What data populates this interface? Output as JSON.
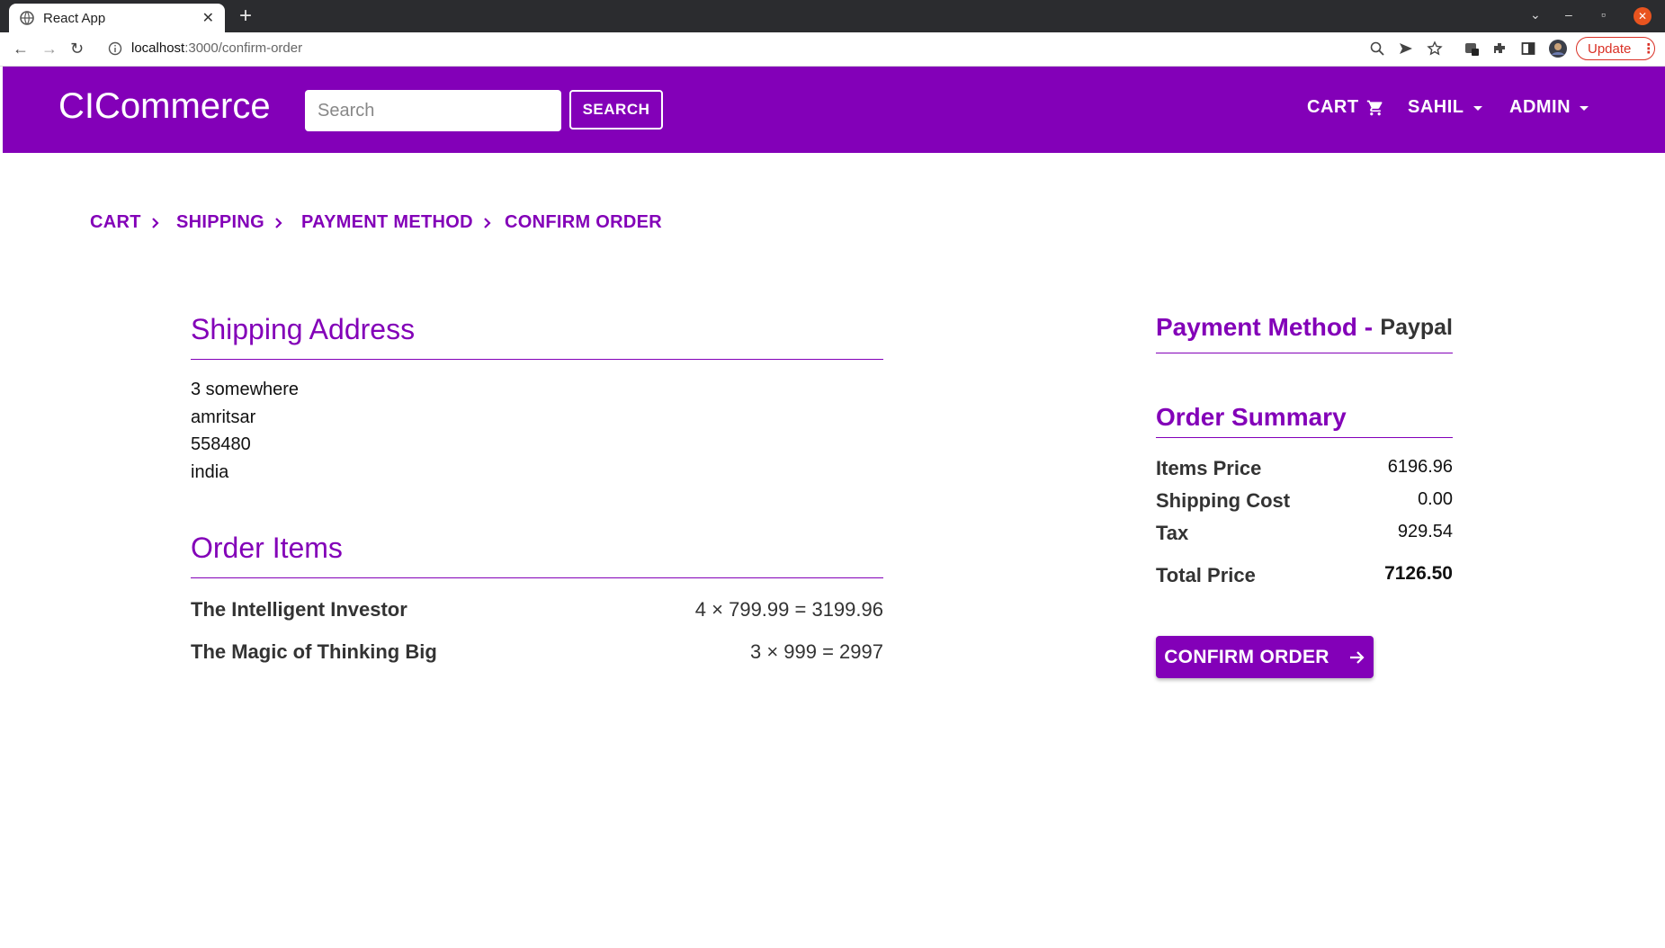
{
  "browser": {
    "tab_title": "React App",
    "url_host": "localhost",
    "url_path": ":3000/confirm-order",
    "update_label": "Update"
  },
  "header": {
    "brand": "CICommerce",
    "search_placeholder": "Search",
    "search_button": "SEARCH",
    "cart_label": "CART",
    "user_label": "SAHIL",
    "admin_label": "ADMIN"
  },
  "steps": [
    "CART",
    "SHIPPING",
    "PAYMENT METHOD",
    "CONFIRM ORDER"
  ],
  "shipping": {
    "title": "Shipping Address",
    "address": "3 somewhere",
    "city": "amritsar",
    "postal_code": "558480",
    "country": "india"
  },
  "order_items": {
    "title": "Order Items",
    "items": [
      {
        "name": "The Intelligent Investor",
        "calc": "4 × 799.99 = 3199.96"
      },
      {
        "name": "The Magic of Thinking Big",
        "calc": "3 × 999 = 2997"
      }
    ]
  },
  "payment": {
    "title": "Payment Method -",
    "method": "Paypal"
  },
  "summary": {
    "title": "Order Summary",
    "items_price_label": "Items Price",
    "items_price": "6196.96",
    "shipping_label": "Shipping Cost",
    "shipping": "0.00",
    "tax_label": "Tax",
    "tax": "929.54",
    "total_label": "Total Price",
    "total": "7126.50"
  },
  "confirm_button": "CONFIRM ORDER",
  "colors": {
    "primary": "#8300b8",
    "browser_dark": "#2b2c2f",
    "update_red": "#d93025"
  }
}
